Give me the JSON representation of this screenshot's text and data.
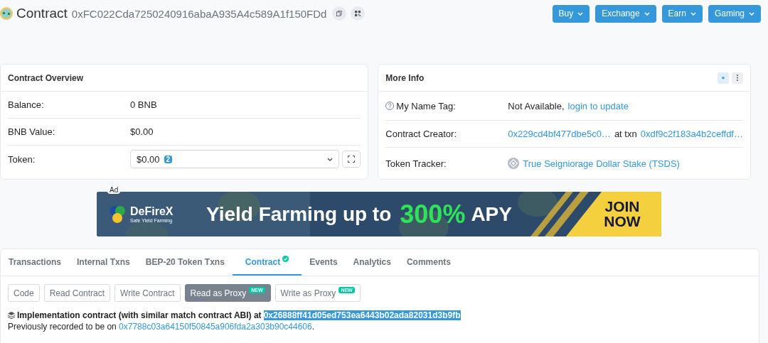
{
  "header": {
    "title": "Contract",
    "address": "0xFC022Cda7250240916abaA935A4c589A1f150FDd",
    "nav": [
      {
        "label": "Buy"
      },
      {
        "label": "Exchange"
      },
      {
        "label": "Earn"
      },
      {
        "label": "Gaming"
      }
    ]
  },
  "overview": {
    "title": "Contract Overview",
    "rows": [
      {
        "kind": "text",
        "label": "Balance:",
        "value": "0 BNB"
      },
      {
        "kind": "text",
        "label": "BNB Value:",
        "value": "$0.00"
      },
      {
        "kind": "select",
        "label": "Token:",
        "value": "$0.00",
        "badge": "2"
      }
    ]
  },
  "more_info": {
    "title": "More Info",
    "rows": [
      {
        "kind": "help",
        "label": "My Name Tag:",
        "parts": [
          {
            "text": "Not Available,",
            "link": false
          },
          {
            "text": "login to update",
            "link": true
          }
        ]
      },
      {
        "kind": "plain",
        "label": "Contract Creator:",
        "parts": [
          {
            "text": "0x229cd4bf477dbe5c0…",
            "link": true
          },
          {
            "text": "at txn",
            "link": false
          },
          {
            "text": "0xdf9c2f183a4b2ceffdf…",
            "link": true
          }
        ]
      },
      {
        "kind": "token",
        "label": "Token Tracker:",
        "parts": [
          {
            "text": "True Seigniorage Dollar Stake (TSDS)",
            "link": true
          }
        ]
      }
    ]
  },
  "ad": {
    "label": "Ad",
    "brand": "DeFireX",
    "tagline": "Safe Yield Farming",
    "headline": "Yield Farming up to",
    "highlight": "300%",
    "suffix": "APY",
    "cta": "JOIN NOW"
  },
  "tabs": [
    {
      "label": "Transactions",
      "selected": false,
      "verified": false
    },
    {
      "label": "Internal Txns",
      "selected": false,
      "verified": false
    },
    {
      "label": "BEP-20 Token Txns",
      "selected": false,
      "verified": false
    },
    {
      "label": "Contract",
      "selected": true,
      "verified": true
    },
    {
      "label": "Events",
      "selected": false,
      "verified": false
    },
    {
      "label": "Analytics",
      "selected": false,
      "verified": false
    },
    {
      "label": "Comments",
      "selected": false,
      "verified": false
    }
  ],
  "subtabs": [
    {
      "label": "Code",
      "selected": false
    },
    {
      "label": "Read Contract",
      "selected": false
    },
    {
      "label": "Write Contract",
      "selected": false
    },
    {
      "label": "Read as Proxy",
      "selected": true,
      "badge": "NEW"
    },
    {
      "label": "Write as Proxy",
      "selected": false,
      "badge": "NEW"
    }
  ],
  "implementation": {
    "text": "Implementation contract (with similar match contract ABI) at",
    "address": "0x26888ff41d05ed753ea6443b02ada82031d3b9fb",
    "highlighted": true
  },
  "previous": {
    "text": "Previously recorded to be on",
    "address": "0x7788c03a64150f50845a906fda2a303b90c44606",
    "end": "."
  }
}
